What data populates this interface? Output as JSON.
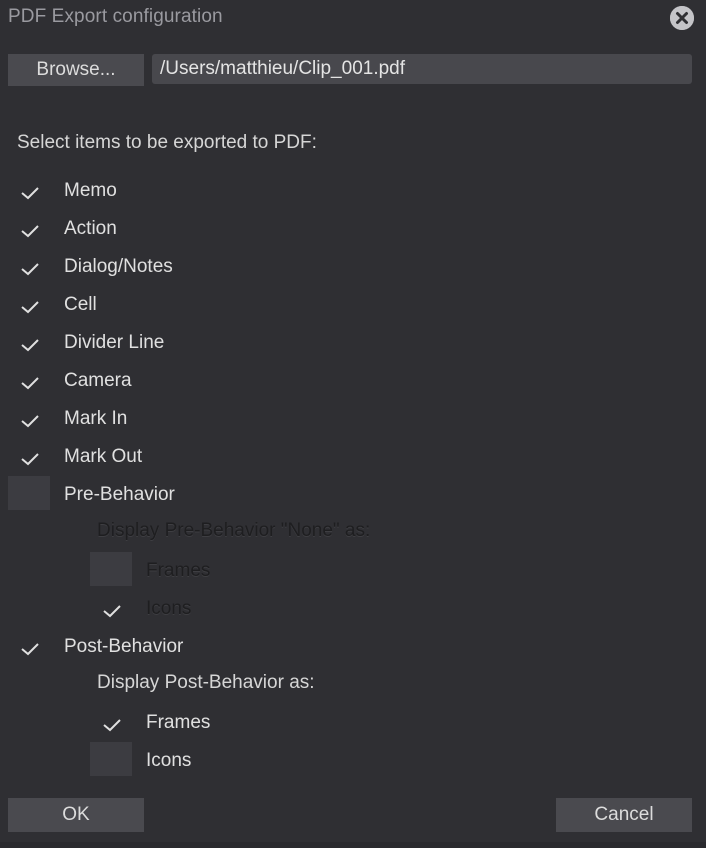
{
  "window": {
    "title": "PDF Export configuration"
  },
  "file": {
    "browse_label": "Browse...",
    "path_value": "/Users/matthieu/Clip_001.pdf"
  },
  "section_label": "Select items to be exported to PDF:",
  "items": [
    {
      "label": "Memo",
      "checked": true
    },
    {
      "label": "Action",
      "checked": true
    },
    {
      "label": "Dialog/Notes",
      "checked": true
    },
    {
      "label": "Cell",
      "checked": true
    },
    {
      "label": "Divider Line",
      "checked": true
    },
    {
      "label": "Camera",
      "checked": true
    },
    {
      "label": "Mark In",
      "checked": true
    },
    {
      "label": "Mark Out",
      "checked": true
    },
    {
      "label": "Pre-Behavior",
      "checked": false
    }
  ],
  "pre_behavior": {
    "label": "Display Pre-Behavior \"None\" as:",
    "options": [
      {
        "label": "Frames",
        "checked": false
      },
      {
        "label": "Icons",
        "checked": true
      }
    ]
  },
  "post_behavior": {
    "item_label": "Post-Behavior",
    "item_checked": true,
    "label": "Display Post-Behavior as:",
    "options": [
      {
        "label": "Frames",
        "checked": true
      },
      {
        "label": "Icons",
        "checked": false
      }
    ]
  },
  "footer": {
    "ok_label": "OK",
    "cancel_label": "Cancel"
  },
  "icons": {
    "close": "close-circle-icon",
    "check": "checkmark-icon"
  },
  "colors": {
    "background": "#2f2f33",
    "control": "#4a4a4f",
    "text": "#e0e0e0"
  }
}
